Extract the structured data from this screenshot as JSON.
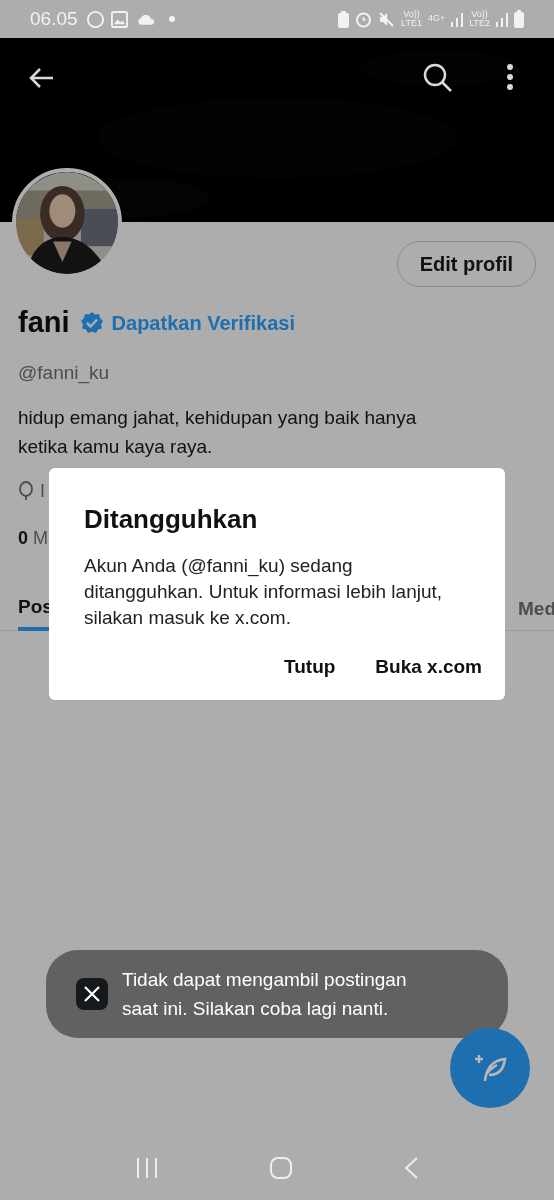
{
  "status_bar": {
    "time": "06.05",
    "net1": "Vo))",
    "net1_sub": "LTE1",
    "net2": "4G+",
    "net3": "Vo))",
    "net3_sub": "LTE2"
  },
  "profile": {
    "edit_button": "Edit profil",
    "name": "fani",
    "verified": true,
    "verify_link": "Dapatkan Verifikasi",
    "handle": "@fanni_ku",
    "bio": "hidup emang jahat, kehidupan yang baik hanya ketika kamu kaya raya.",
    "location_text": "I",
    "stats": "0 M"
  },
  "tabs": [
    {
      "label": "Pos",
      "selected": true
    },
    {
      "label": "Med",
      "selected": false
    }
  ],
  "dialog": {
    "title": "Ditangguhkan",
    "body": "Akun Anda (@fanni_ku) sedang ditangguhkan. Untuk informasi lebih lanjut, silakan masuk ke x.com.",
    "buttons": [
      "Tutup",
      "Buka x.com"
    ]
  },
  "toast": {
    "text": "Tidak dapat mengambil postingan saat ini. Silakan coba lagi nanti."
  }
}
